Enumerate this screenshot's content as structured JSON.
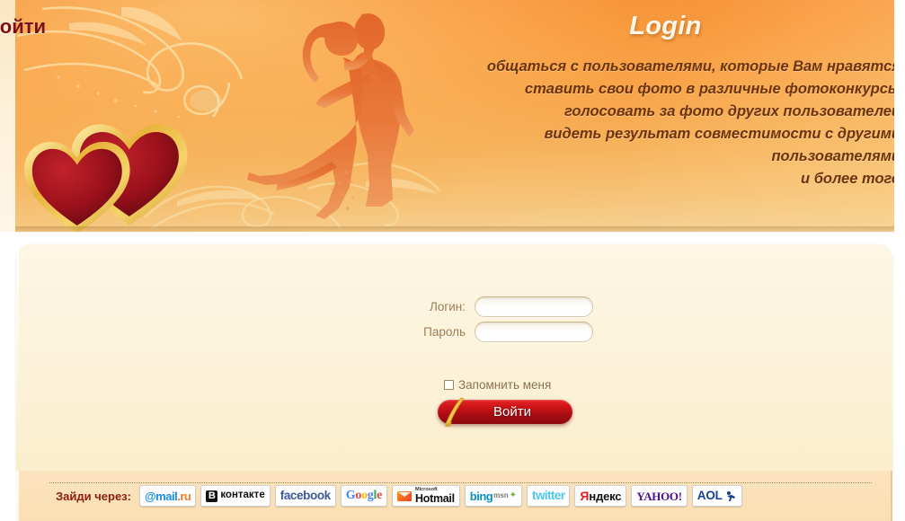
{
  "banner": {
    "title": "Login",
    "lines": [
      "общаться с пользователями, которые Вам нравятся",
      "ставить свои фото в различные фотоконкурсы",
      "голосовать за фото других пользователей",
      "видеть результат совместимости с другими",
      "пользователями",
      "и более того"
    ],
    "decorations": {
      "hearts": "two-hearts-icon",
      "couple": "dancing-couple-silhouette",
      "swirls": "floral-swirl-ornament"
    },
    "colors": {
      "orange_top": "#f6892f",
      "orange_bottom": "#f5d49a",
      "title_text": "#fdf7ec",
      "body_text": "#6d3410"
    }
  },
  "login_form": {
    "heading": "Войти",
    "login_label": "Логин:",
    "login_value": "",
    "login_placeholder": "",
    "password_label": "Пароль",
    "password_value": "",
    "password_placeholder": "",
    "remember_label": "Запомнить меня",
    "remember_checked": false,
    "submit_label": "Войти",
    "colors": {
      "heading": "#7c0f13",
      "label": "#9d7c52",
      "button_red": "#cf1418",
      "panel_bg": "#fdf6e4"
    }
  },
  "social": {
    "label": "Зайди через:",
    "buttons": [
      {
        "name": "mailru",
        "text": "@mail",
        "text2": ".ru"
      },
      {
        "name": "vkontakte",
        "text": "В",
        "text2": "контакте"
      },
      {
        "name": "facebook",
        "text": "facebook"
      },
      {
        "name": "google",
        "text": "Google"
      },
      {
        "name": "hotmail",
        "text": "Microsoft",
        "text2": "Hotmail"
      },
      {
        "name": "bing-msn",
        "text": "bing",
        "text2": "msn"
      },
      {
        "name": "twitter",
        "text": "twitter"
      },
      {
        "name": "yandex",
        "text": "Я",
        "text2": "ндекс"
      },
      {
        "name": "yahoo",
        "text": "YAHOO!"
      },
      {
        "name": "aol",
        "text": "AOL"
      }
    ],
    "bar_color": "#fbe3bd",
    "label_color": "#8d1d0e"
  }
}
